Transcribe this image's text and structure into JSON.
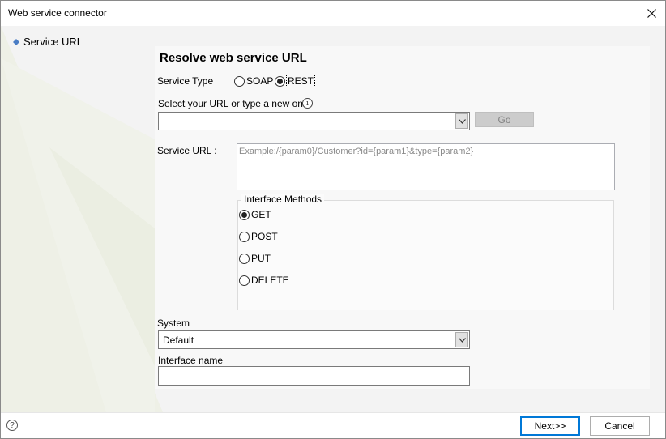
{
  "window": {
    "title": "Web service connector",
    "close_icon": "close-icon"
  },
  "nav": {
    "items": [
      {
        "label": "Service URL",
        "icon": "diamond-bullet-icon",
        "active": true
      }
    ]
  },
  "page": {
    "title": "Resolve web service URL"
  },
  "service_type": {
    "label": "Service Type",
    "options": [
      {
        "label": "SOAP",
        "checked": false
      },
      {
        "label": "REST",
        "checked": true
      }
    ]
  },
  "url_select": {
    "label": "Select your URL or type a new one",
    "info_icon": "info-icon",
    "value": "",
    "go_label": "Go"
  },
  "service_url": {
    "label": "Service URL :",
    "placeholder": "Example:/{param0}/Customer?id={param1}&type={param2}"
  },
  "interface_methods": {
    "title": "Interface Methods",
    "options": [
      {
        "label": "GET",
        "checked": true
      },
      {
        "label": "POST",
        "checked": false
      },
      {
        "label": "PUT",
        "checked": false
      },
      {
        "label": "DELETE",
        "checked": false
      }
    ]
  },
  "system": {
    "label": "System",
    "value": "Default"
  },
  "interface_name": {
    "label": "Interface name",
    "value": ""
  },
  "footer": {
    "help_icon": "help-icon",
    "next_label": "Next>>",
    "cancel_label": "Cancel"
  }
}
